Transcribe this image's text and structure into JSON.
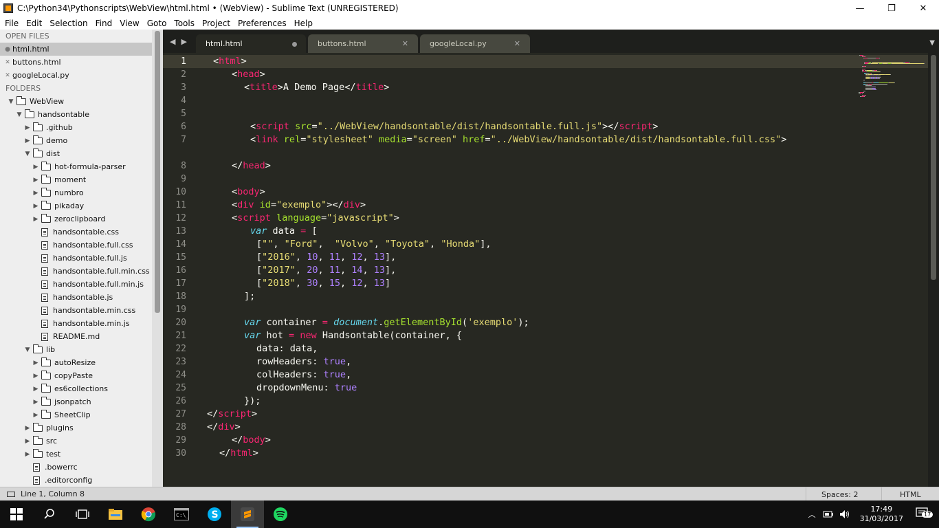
{
  "window": {
    "title": "C:\\Python34\\Pythonscripts\\WebView\\html.html • (WebView) - Sublime Text (UNREGISTERED)",
    "minimize": "—",
    "maximize": "❐",
    "close": "✕"
  },
  "menu": [
    "File",
    "Edit",
    "Selection",
    "Find",
    "View",
    "Goto",
    "Tools",
    "Project",
    "Preferences",
    "Help"
  ],
  "sidebar": {
    "open_files_header": "OPEN FILES",
    "open_files": [
      "html.html",
      "buttons.html",
      "googleLocal.py"
    ],
    "folders_header": "FOLDERS",
    "tree": [
      {
        "label": "WebView",
        "type": "folder",
        "depth": 0,
        "open": true
      },
      {
        "label": "handsontable",
        "type": "folder",
        "depth": 1,
        "open": true
      },
      {
        "label": ".github",
        "type": "folder",
        "depth": 2,
        "open": false
      },
      {
        "label": "demo",
        "type": "folder",
        "depth": 2,
        "open": false
      },
      {
        "label": "dist",
        "type": "folder",
        "depth": 2,
        "open": true
      },
      {
        "label": "hot-formula-parser",
        "type": "folder",
        "depth": 3,
        "open": false
      },
      {
        "label": "moment",
        "type": "folder",
        "depth": 3,
        "open": false
      },
      {
        "label": "numbro",
        "type": "folder",
        "depth": 3,
        "open": false
      },
      {
        "label": "pikaday",
        "type": "folder",
        "depth": 3,
        "open": false
      },
      {
        "label": "zeroclipboard",
        "type": "folder",
        "depth": 3,
        "open": false
      },
      {
        "label": "handsontable.css",
        "type": "file",
        "depth": 3
      },
      {
        "label": "handsontable.full.css",
        "type": "file",
        "depth": 3
      },
      {
        "label": "handsontable.full.js",
        "type": "file",
        "depth": 3
      },
      {
        "label": "handsontable.full.min.css",
        "type": "file",
        "depth": 3
      },
      {
        "label": "handsontable.full.min.js",
        "type": "file",
        "depth": 3
      },
      {
        "label": "handsontable.js",
        "type": "file",
        "depth": 3
      },
      {
        "label": "handsontable.min.css",
        "type": "file",
        "depth": 3
      },
      {
        "label": "handsontable.min.js",
        "type": "file",
        "depth": 3
      },
      {
        "label": "README.md",
        "type": "file",
        "depth": 3
      },
      {
        "label": "lib",
        "type": "folder",
        "depth": 2,
        "open": true
      },
      {
        "label": "autoResize",
        "type": "folder",
        "depth": 3,
        "open": false
      },
      {
        "label": "copyPaste",
        "type": "folder",
        "depth": 3,
        "open": false
      },
      {
        "label": "es6collections",
        "type": "folder",
        "depth": 3,
        "open": false
      },
      {
        "label": "jsonpatch",
        "type": "folder",
        "depth": 3,
        "open": false
      },
      {
        "label": "SheetClip",
        "type": "folder",
        "depth": 3,
        "open": false
      },
      {
        "label": "plugins",
        "type": "folder",
        "depth": 2,
        "open": false
      },
      {
        "label": "src",
        "type": "folder",
        "depth": 2,
        "open": false
      },
      {
        "label": "test",
        "type": "folder",
        "depth": 2,
        "open": false
      },
      {
        "label": ".bowerrc",
        "type": "file",
        "depth": 2
      },
      {
        "label": ".editorconfig",
        "type": "file",
        "depth": 2
      }
    ]
  },
  "tabs": [
    {
      "label": "html.html",
      "active": true,
      "dirty": true
    },
    {
      "label": "buttons.html",
      "active": false,
      "close": "✕"
    },
    {
      "label": "googleLocal.py",
      "active": false,
      "close": "✕"
    }
  ],
  "editor": {
    "current_line": 1,
    "lines": [
      {
        "n": "1",
        "indent": 1,
        "tokens": [
          [
            "p",
            "<"
          ],
          [
            "t",
            "html"
          ],
          [
            "p",
            ">"
          ]
        ]
      },
      {
        "n": "2",
        "indent": 4,
        "tokens": [
          [
            "p",
            "<"
          ],
          [
            "t",
            "head"
          ],
          [
            "p",
            ">"
          ]
        ]
      },
      {
        "n": "3",
        "indent": 6,
        "tokens": [
          [
            "p",
            "<"
          ],
          [
            "t",
            "title"
          ],
          [
            "p",
            ">A Demo Page</"
          ],
          [
            "t",
            "title"
          ],
          [
            "p",
            ">"
          ]
        ]
      },
      {
        "n": "4",
        "indent": 0,
        "tokens": []
      },
      {
        "n": "5",
        "indent": 0,
        "tokens": []
      },
      {
        "n": "6",
        "indent": 7,
        "tokens": [
          [
            "p",
            "<"
          ],
          [
            "t",
            "script"
          ],
          [
            "p",
            " "
          ],
          [
            "a",
            "src"
          ],
          [
            "p",
            "="
          ],
          [
            "s",
            "\"../WebView/handsontable/dist/handsontable.full.js\""
          ],
          [
            "p",
            "></"
          ],
          [
            "t",
            "script"
          ],
          [
            "p",
            ">"
          ]
        ]
      },
      {
        "n": "7",
        "indent": 7,
        "tokens": [
          [
            "p",
            "<"
          ],
          [
            "t",
            "link"
          ],
          [
            "p",
            " "
          ],
          [
            "a",
            "rel"
          ],
          [
            "p",
            "="
          ],
          [
            "s",
            "\"stylesheet\""
          ],
          [
            "p",
            " "
          ],
          [
            "a",
            "media"
          ],
          [
            "p",
            "="
          ],
          [
            "s",
            "\"screen\""
          ],
          [
            "p",
            " "
          ],
          [
            "a",
            "href"
          ],
          [
            "p",
            "="
          ],
          [
            "s",
            "\"../WebView/handsontable/dist/handsontable.full.css\""
          ],
          [
            "p",
            ">"
          ]
        ]
      },
      {
        "n": "",
        "indent": 0,
        "tokens": []
      },
      {
        "n": "8",
        "indent": 4,
        "tokens": [
          [
            "p",
            "</"
          ],
          [
            "t",
            "head"
          ],
          [
            "p",
            ">"
          ]
        ]
      },
      {
        "n": "9",
        "indent": 0,
        "tokens": []
      },
      {
        "n": "10",
        "indent": 4,
        "tokens": [
          [
            "p",
            "<"
          ],
          [
            "t",
            "body"
          ],
          [
            "p",
            ">"
          ]
        ]
      },
      {
        "n": "11",
        "indent": 4,
        "tokens": [
          [
            "p",
            "<"
          ],
          [
            "t",
            "div"
          ],
          [
            "p",
            " "
          ],
          [
            "a",
            "id"
          ],
          [
            "p",
            "="
          ],
          [
            "s",
            "\"exemplo\""
          ],
          [
            "p",
            "></"
          ],
          [
            "t",
            "div"
          ],
          [
            "p",
            ">"
          ]
        ]
      },
      {
        "n": "12",
        "indent": 4,
        "tokens": [
          [
            "p",
            "<"
          ],
          [
            "t",
            "script"
          ],
          [
            "p",
            " "
          ],
          [
            "a",
            "language"
          ],
          [
            "p",
            "="
          ],
          [
            "s",
            "\"javascript\""
          ],
          [
            "p",
            ">"
          ]
        ]
      },
      {
        "n": "13",
        "indent": 7,
        "tokens": [
          [
            "k",
            "var"
          ],
          [
            "p",
            " data "
          ],
          [
            "t",
            "="
          ],
          [
            "p",
            " ["
          ]
        ]
      },
      {
        "n": "14",
        "indent": 8,
        "tokens": [
          [
            "p",
            "["
          ],
          [
            "s",
            "\"\""
          ],
          [
            "p",
            ", "
          ],
          [
            "s",
            "\"Ford\""
          ],
          [
            "p",
            ",  "
          ],
          [
            "s",
            "\"Volvo\""
          ],
          [
            "p",
            ", "
          ],
          [
            "s",
            "\"Toyota\""
          ],
          [
            "p",
            ", "
          ],
          [
            "s",
            "\"Honda\""
          ],
          [
            "p",
            "],"
          ]
        ]
      },
      {
        "n": "15",
        "indent": 8,
        "tokens": [
          [
            "p",
            "["
          ],
          [
            "s",
            "\"2016\""
          ],
          [
            "p",
            ", "
          ],
          [
            "n",
            "10"
          ],
          [
            "p",
            ", "
          ],
          [
            "n",
            "11"
          ],
          [
            "p",
            ", "
          ],
          [
            "n",
            "12"
          ],
          [
            "p",
            ", "
          ],
          [
            "n",
            "13"
          ],
          [
            "p",
            "],"
          ]
        ]
      },
      {
        "n": "16",
        "indent": 8,
        "tokens": [
          [
            "p",
            "["
          ],
          [
            "s",
            "\"2017\""
          ],
          [
            "p",
            ", "
          ],
          [
            "n",
            "20"
          ],
          [
            "p",
            ", "
          ],
          [
            "n",
            "11"
          ],
          [
            "p",
            ", "
          ],
          [
            "n",
            "14"
          ],
          [
            "p",
            ", "
          ],
          [
            "n",
            "13"
          ],
          [
            "p",
            "],"
          ]
        ]
      },
      {
        "n": "17",
        "indent": 8,
        "tokens": [
          [
            "p",
            "["
          ],
          [
            "s",
            "\"2018\""
          ],
          [
            "p",
            ", "
          ],
          [
            "n",
            "30"
          ],
          [
            "p",
            ", "
          ],
          [
            "n",
            "15"
          ],
          [
            "p",
            ", "
          ],
          [
            "n",
            "12"
          ],
          [
            "p",
            ", "
          ],
          [
            "n",
            "13"
          ],
          [
            "p",
            "]"
          ]
        ]
      },
      {
        "n": "18",
        "indent": 6,
        "tokens": [
          [
            "p",
            "];"
          ]
        ]
      },
      {
        "n": "19",
        "indent": 0,
        "tokens": []
      },
      {
        "n": "20",
        "indent": 6,
        "tokens": [
          [
            "k",
            "var"
          ],
          [
            "p",
            " container "
          ],
          [
            "t",
            "="
          ],
          [
            "p",
            " "
          ],
          [
            "k",
            "document"
          ],
          [
            "p",
            "."
          ],
          [
            "f",
            "getElementById"
          ],
          [
            "p",
            "("
          ],
          [
            "s",
            "'exemplo'"
          ],
          [
            "p",
            ");"
          ]
        ]
      },
      {
        "n": "21",
        "indent": 6,
        "tokens": [
          [
            "k",
            "var"
          ],
          [
            "p",
            " hot "
          ],
          [
            "t",
            "="
          ],
          [
            "p",
            " "
          ],
          [
            "t",
            "new"
          ],
          [
            "p",
            " Handsontable(container, {"
          ]
        ]
      },
      {
        "n": "22",
        "indent": 8,
        "tokens": [
          [
            "p",
            "data: data,"
          ]
        ]
      },
      {
        "n": "23",
        "indent": 8,
        "tokens": [
          [
            "p",
            "rowHeaders: "
          ],
          [
            "n",
            "true"
          ],
          [
            "p",
            ","
          ]
        ]
      },
      {
        "n": "24",
        "indent": 8,
        "tokens": [
          [
            "p",
            "colHeaders: "
          ],
          [
            "n",
            "true"
          ],
          [
            "p",
            ","
          ]
        ]
      },
      {
        "n": "25",
        "indent": 8,
        "tokens": [
          [
            "p",
            "dropdownMenu: "
          ],
          [
            "n",
            "true"
          ]
        ]
      },
      {
        "n": "26",
        "indent": 6,
        "tokens": [
          [
            "p",
            "});"
          ]
        ]
      },
      {
        "n": "27",
        "indent": 0,
        "tokens": [
          [
            "p",
            "</"
          ],
          [
            "t",
            "script"
          ],
          [
            "p",
            ">"
          ]
        ]
      },
      {
        "n": "28",
        "indent": 0,
        "tokens": [
          [
            "p",
            "</"
          ],
          [
            "t",
            "div"
          ],
          [
            "p",
            ">"
          ]
        ]
      },
      {
        "n": "29",
        "indent": 4,
        "tokens": [
          [
            "p",
            "</"
          ],
          [
            "t",
            "body"
          ],
          [
            "p",
            ">"
          ]
        ]
      },
      {
        "n": "30",
        "indent": 2,
        "tokens": [
          [
            "p",
            "</"
          ],
          [
            "t",
            "html"
          ],
          [
            "p",
            ">"
          ]
        ]
      }
    ]
  },
  "status": {
    "position": "Line 1, Column 8",
    "spaces": "Spaces: 2",
    "syntax": "HTML"
  },
  "taskbar": {
    "time": "17:49",
    "date": "31/03/2017",
    "notifications": "17",
    "apps": [
      "windows-start",
      "search",
      "task-view",
      "file-explorer",
      "chrome",
      "command-prompt",
      "skype",
      "sublime-text",
      "spotify"
    ]
  },
  "colors": {
    "editor_bg": "#272822",
    "tag": "#f92672",
    "attribute": "#a6e22e",
    "string": "#e6db74",
    "number": "#ae81ff",
    "keyword": "#66d9ef"
  }
}
